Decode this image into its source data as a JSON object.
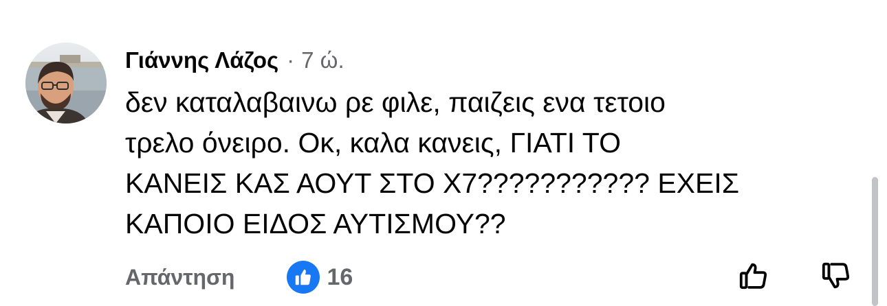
{
  "comment": {
    "author_name": "Γιάννης Λάζος",
    "separator": "·",
    "timestamp": "7 ώ.",
    "text": "δεν καταλαβαινω ρε φιλε, παιζεις ενα τετοιο\nτρελο όνειρο. Οκ, καλα κανεις, ΓΙΑΤΙ ΤΟ\nΚΑΝΕΙΣ ΚΑΣ ΑΟΥΤ ΣΤΟ Χ7??????????? ΕΧΕΙΣ\nΚΑΠΟΙΟ ΕΙΔΟΣ ΑΥΤΙΣΜΟΥ??",
    "reply_label": "Απάντηση",
    "like_count": "16",
    "reaction_icon": "like-thumb-icon"
  },
  "icons": {
    "upvote": "thumbs-up-outline-icon",
    "downvote": "thumbs-down-outline-icon"
  },
  "colors": {
    "primary_text": "#050505",
    "secondary_text": "#65676b",
    "like_blue": "#1877f2",
    "scrollbar": "#c2c3c6"
  }
}
